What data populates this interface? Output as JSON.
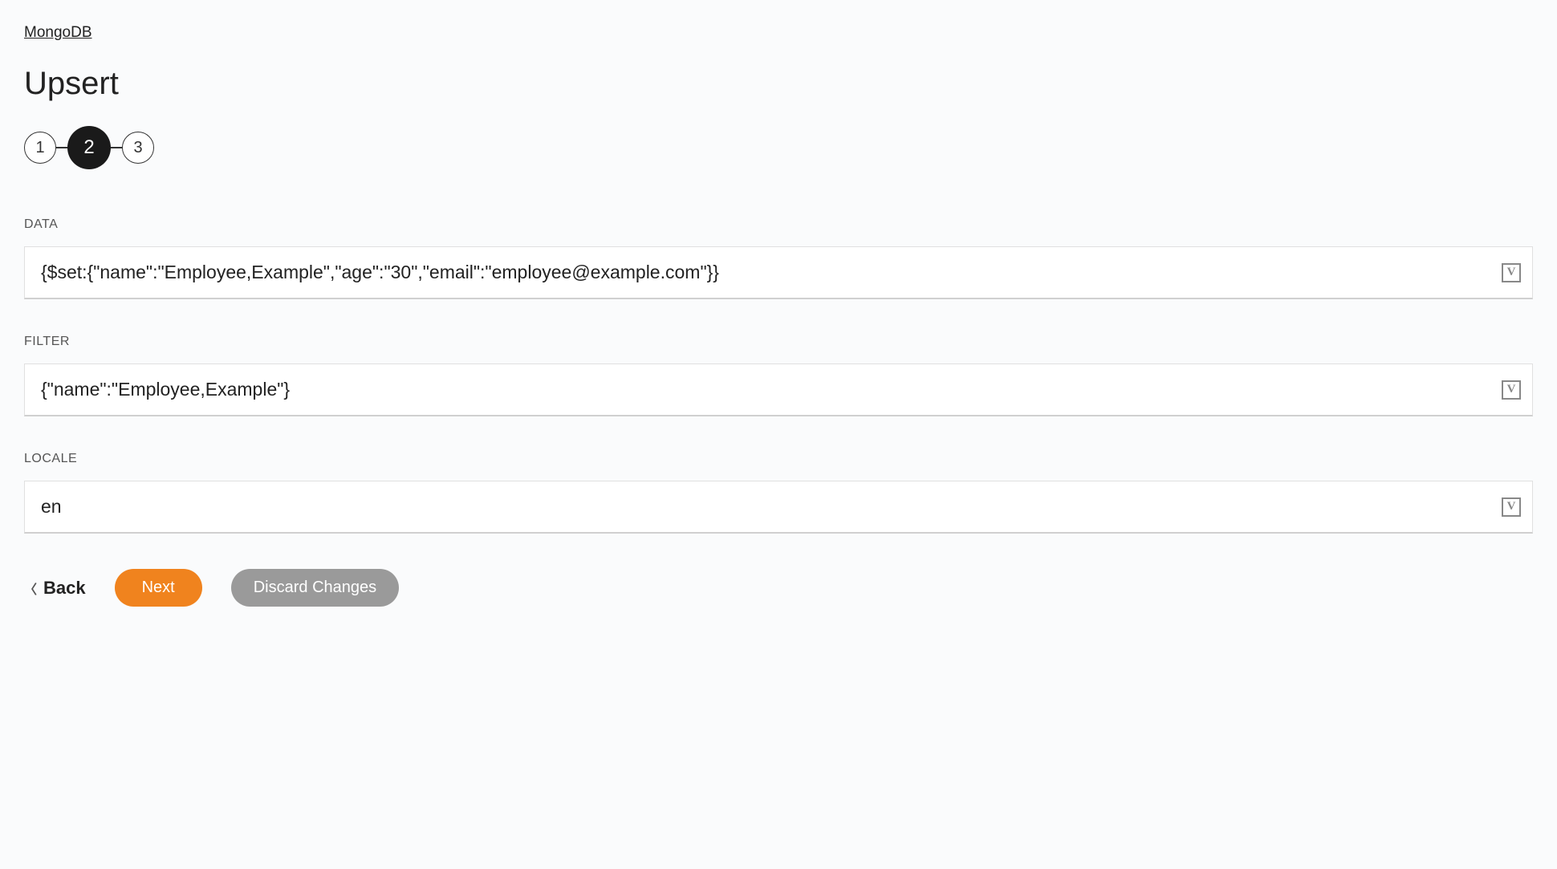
{
  "breadcrumb": "MongoDB",
  "page_title": "Upsert",
  "stepper": {
    "steps": [
      {
        "label": "1",
        "active": false
      },
      {
        "label": "2",
        "active": true
      },
      {
        "label": "3",
        "active": false
      }
    ]
  },
  "fields": {
    "data": {
      "label": "DATA",
      "value": "{$set:{\"name\":\"Employee,Example\",\"age\":\"30\",\"email\":\"employee@example.com\"}}"
    },
    "filter": {
      "label": "FILTER",
      "value": "{\"name\":\"Employee,Example\"}"
    },
    "locale": {
      "label": "LOCALE",
      "value": "en"
    }
  },
  "var_icon_label": "V",
  "buttons": {
    "back": "Back",
    "next": "Next",
    "discard": "Discard Changes"
  }
}
